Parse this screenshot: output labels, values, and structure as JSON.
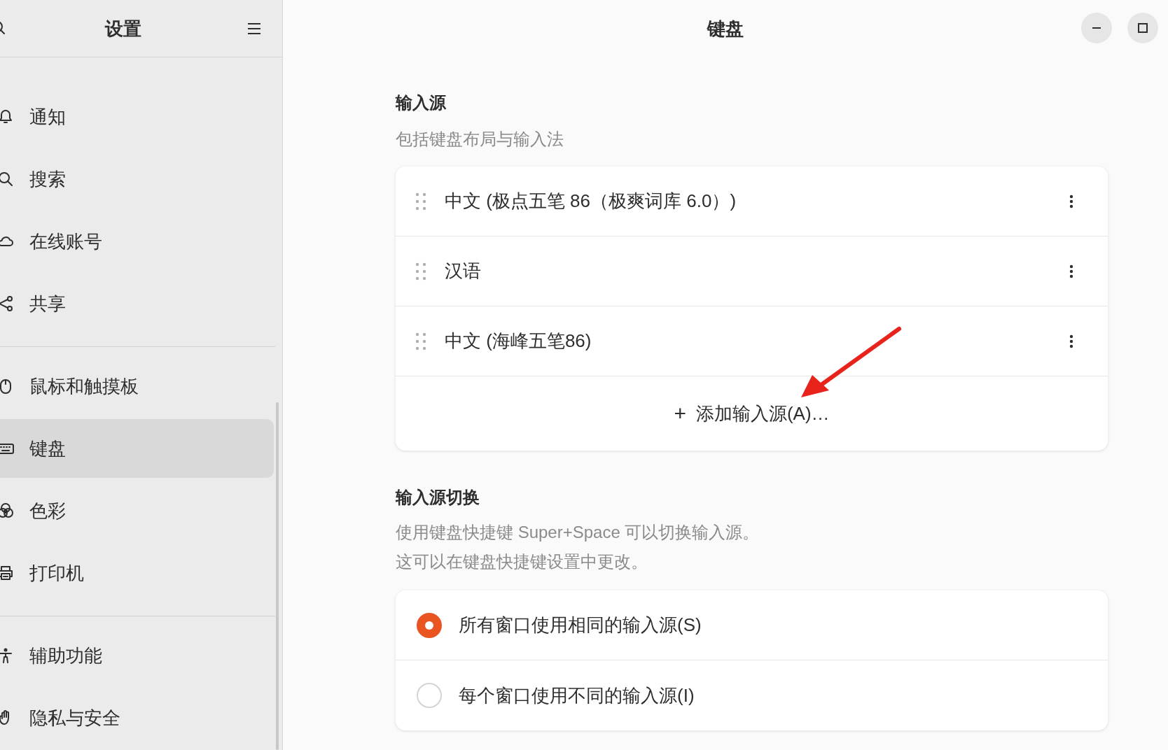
{
  "sidebar": {
    "title": "设置",
    "groups": [
      {
        "items": [
          {
            "label": "通知",
            "kind": "bell",
            "selected": false
          },
          {
            "label": "搜索",
            "kind": "search",
            "selected": false
          },
          {
            "label": "在线账号",
            "kind": "cloud",
            "selected": false
          },
          {
            "label": "共享",
            "kind": "share",
            "selected": false
          }
        ]
      },
      {
        "items": [
          {
            "label": "鼠标和触摸板",
            "kind": "mouse",
            "selected": false
          },
          {
            "label": "键盘",
            "kind": "keyboard",
            "selected": true
          },
          {
            "label": "色彩",
            "kind": "color",
            "selected": false
          },
          {
            "label": "打印机",
            "kind": "printer",
            "selected": false
          }
        ]
      },
      {
        "items": [
          {
            "label": "辅助功能",
            "kind": "person",
            "selected": false
          },
          {
            "label": "隐私与安全",
            "kind": "hand",
            "selected": false
          }
        ]
      }
    ]
  },
  "page": {
    "title": "键盘",
    "input_sources": {
      "heading": "输入源",
      "description": "包括键盘布局与输入法",
      "sources": [
        {
          "label": "中文 (极点五笔 86（极爽词库 6.0）)"
        },
        {
          "label": "汉语"
        },
        {
          "label": "中文 (海峰五笔86)"
        }
      ],
      "add_button": {
        "icon": "+",
        "label": "添加输入源(A)…"
      }
    },
    "switching": {
      "heading": "输入源切换",
      "description": [
        "使用键盘快捷键 Super+Space 可以切换输入源。",
        "这可以在键盘快捷键设置中更改。"
      ],
      "options": [
        {
          "label": "所有窗口使用相同的输入源(S)",
          "selected": true
        },
        {
          "label": "每个窗口使用不同的输入源(I)",
          "selected": false
        }
      ]
    }
  },
  "annotation": {
    "kind": "arrow",
    "color": "#e8231c"
  }
}
